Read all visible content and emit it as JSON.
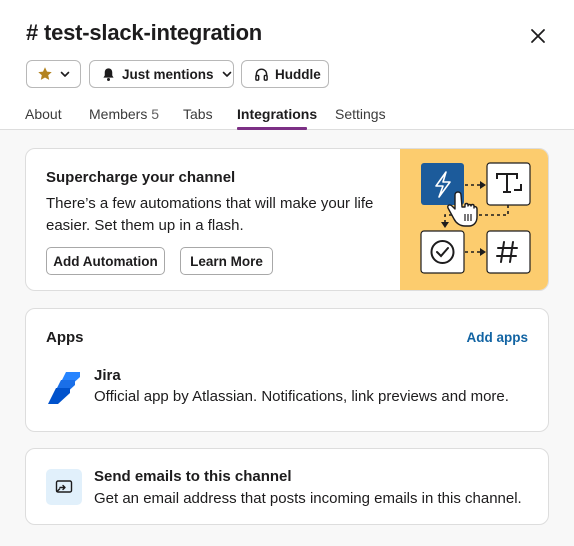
{
  "header": {
    "title": "# test-slack-integration",
    "buttons": {
      "notifications_label": "Just mentions",
      "huddle_label": "Huddle"
    },
    "tabs": [
      {
        "label": "About"
      },
      {
        "label": "Members",
        "count": "5"
      },
      {
        "label": "Tabs"
      },
      {
        "label": "Integrations",
        "active": true
      },
      {
        "label": "Settings"
      }
    ]
  },
  "automation_card": {
    "title": "Supercharge your channel",
    "description": "There’s a few automations that will make your life easier. Set them up in a flash.",
    "add_button": "Add Automation",
    "learn_button": "Learn More"
  },
  "apps_card": {
    "title": "Apps",
    "add_link": "Add apps",
    "apps": [
      {
        "name": "Jira",
        "description": "Official app by Atlassian. Notifications, link previews and more."
      }
    ]
  },
  "email_card": {
    "title": "Send emails to this channel",
    "description": "Get an email address that posts incoming emails in this channel."
  },
  "colors": {
    "accent": "#7c3085",
    "link": "#1264a3",
    "star": "#b3831f",
    "illustration_bg": "#fccc6e",
    "automation_tile": "#1c5b9b",
    "jira_blue": "#2684ff"
  },
  "icons": [
    "star-icon",
    "chevron-down-icon",
    "bell-icon",
    "headphones-icon",
    "close-icon",
    "lightning-icon",
    "text-icon",
    "check-circle-icon",
    "hash-icon",
    "hand-cursor-icon",
    "jira-logo-icon",
    "email-channel-icon"
  ]
}
